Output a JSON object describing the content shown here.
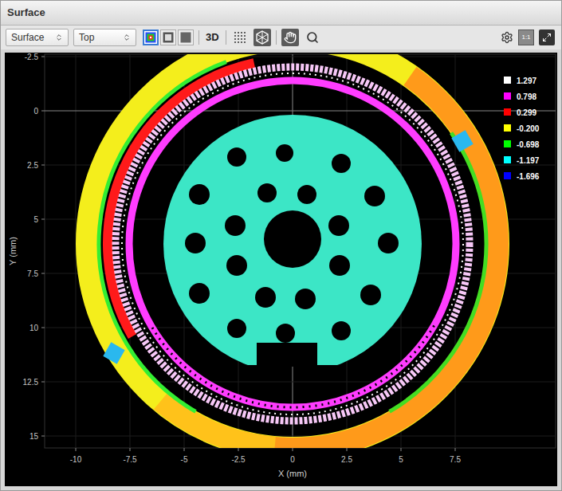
{
  "window": {
    "title": "Surface"
  },
  "toolbar": {
    "view_select": {
      "value": "Surface"
    },
    "orientation_select": {
      "value": "Top"
    },
    "display_modes": [
      {
        "kind": "heightmap",
        "selected": true
      },
      {
        "kind": "intensity",
        "selected": false
      },
      {
        "kind": "flat",
        "selected": false
      }
    ],
    "three_d": "3D",
    "tools": [
      {
        "kind": "points",
        "selected": false
      },
      {
        "kind": "mesh",
        "selected": true
      },
      {
        "kind": "pan",
        "selected": true
      },
      {
        "kind": "zoom",
        "selected": false
      }
    ],
    "actual_size": {
      "label": "1:1",
      "selected": true
    }
  },
  "chart": {
    "x_axis": {
      "title": "X (mm)",
      "ticks": [
        "-10",
        "-7.5",
        "-5",
        "-2.5",
        "0",
        "2.5",
        "5",
        "7.5"
      ]
    },
    "y_axis": {
      "title": "Y (mm)",
      "ticks": [
        "-2.5",
        "0",
        "2.5",
        "5",
        "7.5",
        "10",
        "12.5",
        "15"
      ]
    },
    "legend": [
      {
        "label": "1.297",
        "color": "#ffffff"
      },
      {
        "label": "0.798",
        "color": "#ff00ff"
      },
      {
        "label": "0.299",
        "color": "#ff0000"
      },
      {
        "label": "-0.200",
        "color": "#ffff00"
      },
      {
        "label": "-0.698",
        "color": "#00ff00"
      },
      {
        "label": "-1.197",
        "color": "#00ffff"
      },
      {
        "label": "-1.696",
        "color": "#0000ff"
      }
    ]
  }
}
